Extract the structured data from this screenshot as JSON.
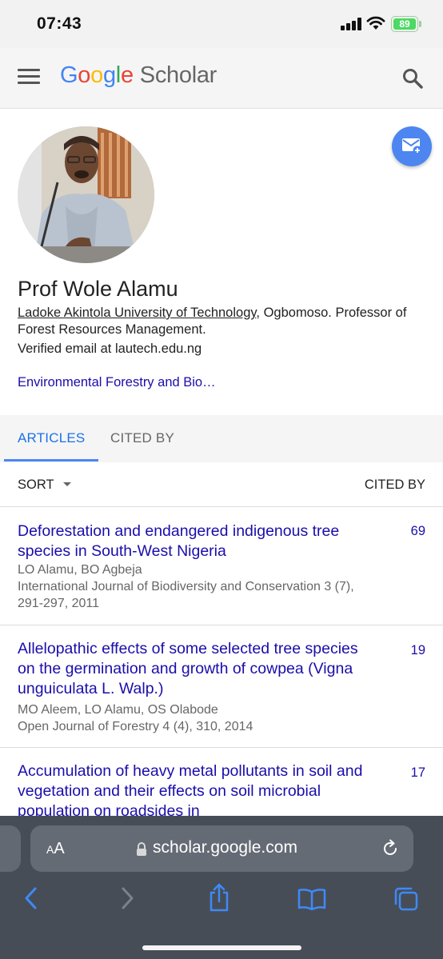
{
  "status_bar": {
    "time": "07:43",
    "battery": "89"
  },
  "header": {
    "logo_google": [
      "G",
      "o",
      "o",
      "g",
      "l",
      "e"
    ],
    "logo_scholar": "Scholar"
  },
  "profile": {
    "name": "Prof Wole Alamu",
    "organization": "Ladoke Akintola University of Technology",
    "affiliation_rest": ", Ogbomoso. Professor of Forest Resources Management.",
    "email": "Verified email at lautech.edu.ng",
    "interest": "Environmental Forestry and Bio…"
  },
  "tabs": {
    "articles": "ARTICLES",
    "cited_by": "CITED BY"
  },
  "list_header": {
    "sort": "SORT",
    "cited_by": "CITED BY"
  },
  "articles": [
    {
      "title": "Deforestation and endangered indigenous tree species in South-West Nigeria",
      "authors": "LO Alamu, BO Agbeja",
      "venue": "International Journal of Biodiversity and Conservation 3 (7), 291-297, 2011",
      "cited_by": "69"
    },
    {
      "title": "Allelopathic effects of some selected tree species on the germination and growth of cowpea (Vigna unguiculata L. Walp.)",
      "authors": "MO Aleem, LO Alamu, OS Olabode",
      "venue": "Open Journal of Forestry 4 (4), 310, 2014",
      "cited_by": "19"
    },
    {
      "title": "Accumulation of heavy metal pollutants in soil and vegetation and their effects on soil microbial population on roadsides in",
      "authors": "",
      "venue": "",
      "cited_by": "17"
    }
  ],
  "browser": {
    "aa_small": "A",
    "aa_big": "A",
    "url": "scholar.google.com"
  },
  "colors": {
    "link": "#1a0dab",
    "accent": "#1a73e8",
    "fab": "#4d86f0",
    "safari_bar": "#474d57"
  },
  "icons": [
    "menu-icon",
    "search-icon",
    "email-plus-icon",
    "lock-icon",
    "reload-icon",
    "back-icon",
    "forward-icon",
    "share-icon",
    "bookmarks-icon",
    "tabs-icon"
  ]
}
